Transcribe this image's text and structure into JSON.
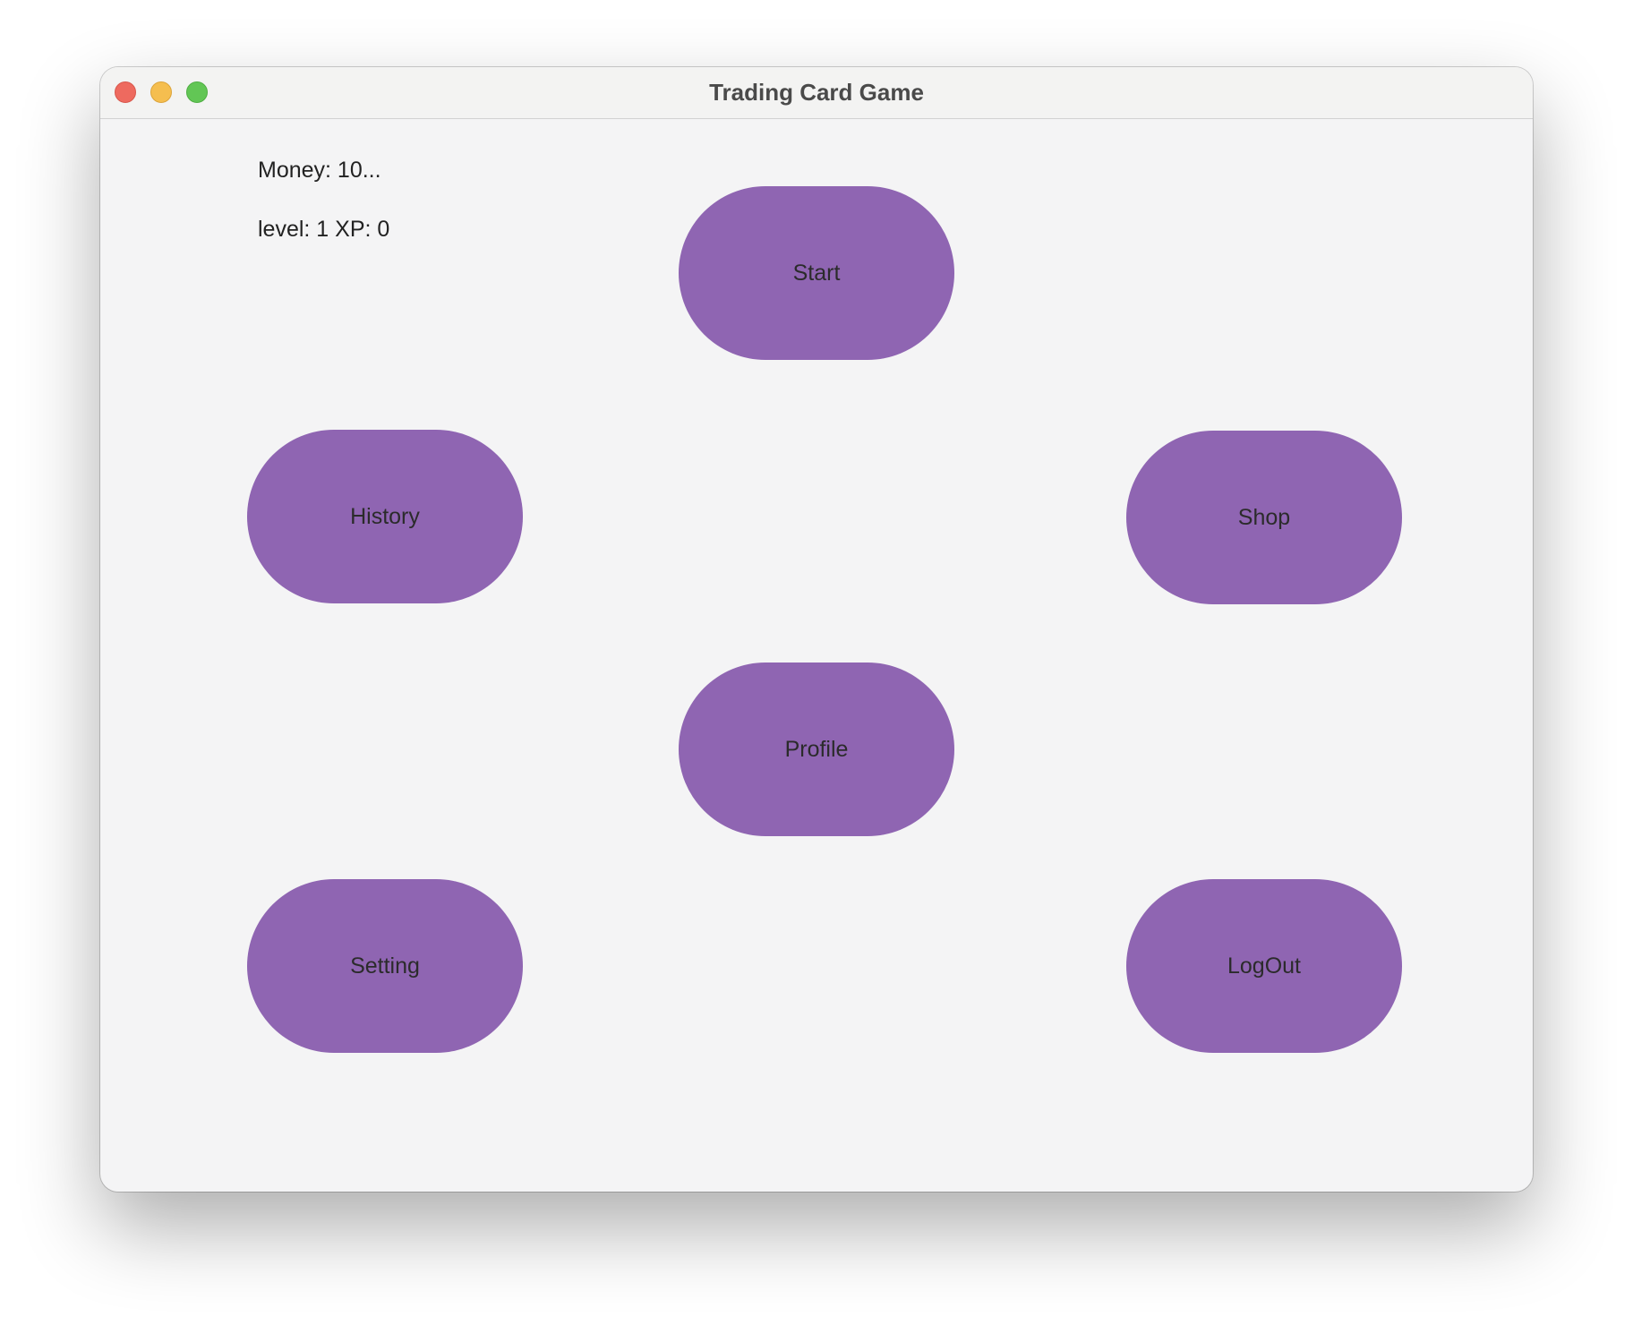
{
  "window": {
    "title": "Trading Card Game"
  },
  "stats": {
    "money": "Money: 10...",
    "level_xp": "level: 1 XP: 0"
  },
  "buttons": {
    "start": "Start",
    "history": "History",
    "shop": "Shop",
    "profile": "Profile",
    "setting": "Setting",
    "logout": "LogOut"
  },
  "colors": {
    "button_fill": "#8f65b2",
    "window_bg": "#f4f4f5",
    "close": "#ee6a5f",
    "minimize": "#f5be4f",
    "zoom": "#62c655"
  }
}
